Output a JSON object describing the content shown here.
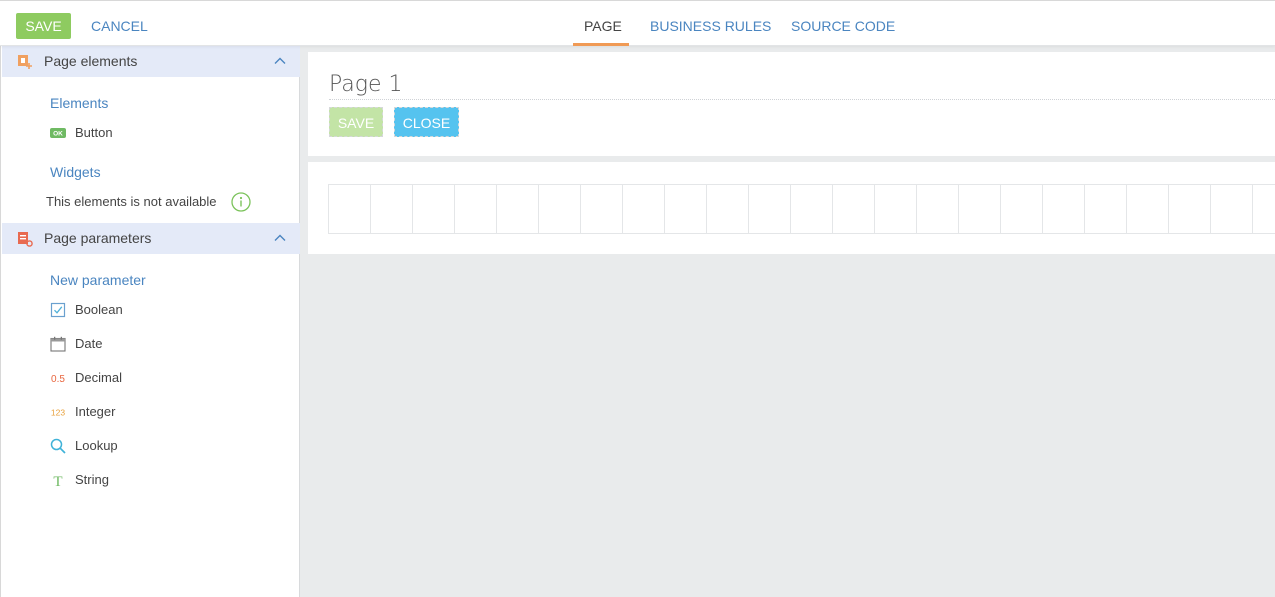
{
  "toolbar": {
    "save_label": "SAVE",
    "cancel_label": "CANCEL",
    "tabs": [
      {
        "label": "PAGE",
        "active": true
      },
      {
        "label": "BUSINESS RULES",
        "active": false
      },
      {
        "label": "SOURCE CODE",
        "active": false
      }
    ]
  },
  "sidebar": {
    "page_elements": {
      "title": "Page elements",
      "elements_heading": "Elements",
      "items": [
        {
          "label": "Button",
          "icon": "ok-button-icon"
        }
      ],
      "widgets_heading": "Widgets",
      "widgets_note": "This elements is not available"
    },
    "page_parameters": {
      "title": "Page parameters",
      "new_parameter_heading": "New parameter",
      "items": [
        {
          "label": "Boolean",
          "icon": "checkbox-icon"
        },
        {
          "label": "Date",
          "icon": "calendar-icon"
        },
        {
          "label": "Decimal",
          "icon": "decimal-icon",
          "icon_text": "0.5"
        },
        {
          "label": "Integer",
          "icon": "integer-icon",
          "icon_text": "123"
        },
        {
          "label": "Lookup",
          "icon": "search-icon"
        },
        {
          "label": "String",
          "icon": "text-icon",
          "icon_text": "T"
        }
      ]
    }
  },
  "canvas": {
    "page_title": "Page 1",
    "save_label": "SAVE",
    "close_label": "CLOSE"
  },
  "colors": {
    "save_green": "#8ecb60",
    "link_blue": "#4a85c0",
    "tab_underline": "#f09a55",
    "section_bg": "#e4eaf8",
    "close_blue": "#55c3ef",
    "canvas_bg": "#e9ebec"
  }
}
